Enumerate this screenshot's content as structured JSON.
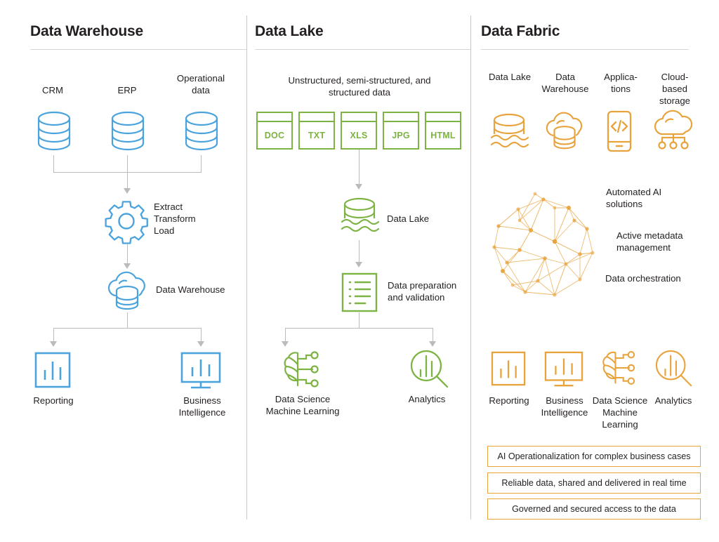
{
  "colors": {
    "blue": "#4ba3dd",
    "green": "#7cb342",
    "orange": "#e8a33d",
    "line": "#b9bbbd",
    "text": "#231f20",
    "divider": "#c6c8ca"
  },
  "columns": {
    "warehouse": {
      "title": "Data Warehouse",
      "sources": [
        {
          "label": "CRM",
          "icon": "database-icon"
        },
        {
          "label": "ERP",
          "icon": "database-icon"
        },
        {
          "label": "Operational\ndata",
          "icon": "database-icon"
        }
      ],
      "etl": {
        "label": "Extract\nTransform\nLoad",
        "icon": "gear-icon"
      },
      "store": {
        "label": "Data Warehouse",
        "icon": "cloud-database-icon"
      },
      "outputs": [
        {
          "label": "Reporting",
          "icon": "bar-chart-icon"
        },
        {
          "label": "Business\nIntelligence",
          "icon": "monitor-chart-icon"
        }
      ]
    },
    "lake": {
      "title": "Data Lake",
      "intro": "Unstructured, semi-structured, and\nstructured data",
      "filetypes": [
        {
          "label": "DOC",
          "icon": "file-icon"
        },
        {
          "label": "TXT",
          "icon": "file-icon"
        },
        {
          "label": "XLS",
          "icon": "file-icon"
        },
        {
          "label": "JPG",
          "icon": "file-icon"
        },
        {
          "label": "HTML",
          "icon": "file-icon"
        }
      ],
      "store": {
        "label": "Data Lake",
        "icon": "data-lake-icon"
      },
      "prep": {
        "label": "Data preparation\nand validation",
        "icon": "checklist-icon"
      },
      "outputs": [
        {
          "label": "Data Science\nMachine Learning",
          "icon": "brain-circuit-icon"
        },
        {
          "label": "Analytics",
          "icon": "magnifier-chart-icon"
        }
      ]
    },
    "fabric": {
      "title": "Data Fabric",
      "sources": [
        {
          "label": "Data Lake",
          "icon": "data-lake-icon"
        },
        {
          "label": "Data\nWarehouse",
          "icon": "cloud-database-icon"
        },
        {
          "label": "Applica-\ntions",
          "icon": "mobile-code-icon"
        },
        {
          "label": "Cloud-\nbased\nstorage",
          "icon": "cloud-network-icon"
        }
      ],
      "network": {
        "icon": "network-sphere-icon"
      },
      "capabilities": [
        "Automated AI\nsolutions",
        "Active metadata\nmanagement",
        "Data orchestration"
      ],
      "outputs": [
        {
          "label": "Reporting",
          "icon": "bar-chart-icon"
        },
        {
          "label": "Business\nIntelligence",
          "icon": "monitor-chart-icon"
        },
        {
          "label": "Data Science\nMachine\nLearning",
          "icon": "brain-circuit-icon"
        },
        {
          "label": "Analytics",
          "icon": "magnifier-chart-icon"
        }
      ],
      "statements": [
        "AI Operationalization for complex business cases",
        "Reliable data, shared and delivered in real time",
        "Governed and secured access to the data"
      ]
    }
  }
}
